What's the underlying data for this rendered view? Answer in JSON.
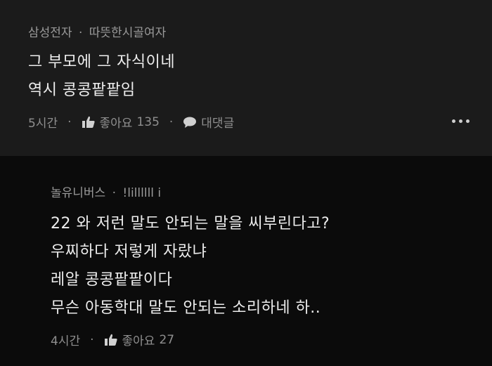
{
  "comment": {
    "author": "삼성전자",
    "separator": "·",
    "nickname": "따뜻한시골여자",
    "lines": [
      "그 부모에 그 자식이네",
      "역시 콩콩팥팥임"
    ],
    "time": "5시간",
    "like_label": "좋아요",
    "like_count": "135",
    "reply_label": "대댓글"
  },
  "reply": {
    "author": "놀유니버스",
    "separator": "·",
    "nickname": "!lillllll i",
    "lines": [
      "22 와 저런 말도 안되는 말을 씨부린다고?",
      "우찌하다 저렇게 자랐냐",
      "레알 콩콩팥팥이다",
      "무슨 아동학대 말도 안되는 소리하네 하.."
    ],
    "time": "4시간",
    "like_label": "좋아요",
    "like_count": "27"
  },
  "icons": {
    "like": "thumbs-up-icon",
    "reply": "speech-bubble-icon",
    "more": "more-dots-icon"
  }
}
